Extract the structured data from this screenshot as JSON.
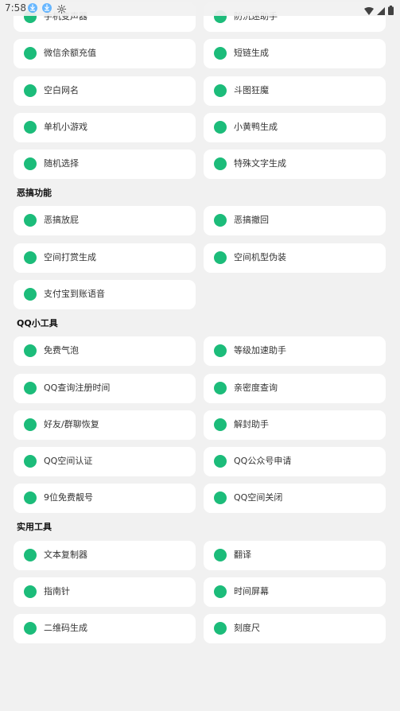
{
  "status_bar": {
    "time": "7:58",
    "icons": [
      "download-icon",
      "download-icon",
      "gear-icon",
      "wifi-icon",
      "signal-icon",
      "battery-icon"
    ]
  },
  "colors": {
    "accent": "#1cbc7a",
    "background": "#f1f1f1",
    "card": "#ffffff",
    "text": "#333333"
  },
  "sections": [
    {
      "title": "",
      "items": [
        "手机变声器",
        "防沉迷助手",
        "微信余额充值",
        "短链生成",
        "空白网名",
        "斗图狂魔",
        "单机小游戏",
        "小黄鸭生成",
        "随机选择",
        "特殊文字生成"
      ]
    },
    {
      "title": "恶搞功能",
      "items": [
        "恶搞放屁",
        "恶搞撤回",
        "空间打赏生成",
        "空间机型伪装",
        "支付宝到账语音"
      ]
    },
    {
      "title": "QQ小工具",
      "items": [
        "免费气泡",
        "等级加速助手",
        "QQ查询注册时间",
        "亲密度查询",
        "好友/群聊恢复",
        "解封助手",
        "QQ空间认证",
        "QQ公众号申请",
        "9位免费靓号",
        "QQ空间关闭"
      ]
    },
    {
      "title": "实用工具",
      "items": [
        "文本复制器",
        "翻译",
        "指南针",
        "时间屏幕",
        "二维码生成",
        "刻度尺"
      ]
    }
  ]
}
